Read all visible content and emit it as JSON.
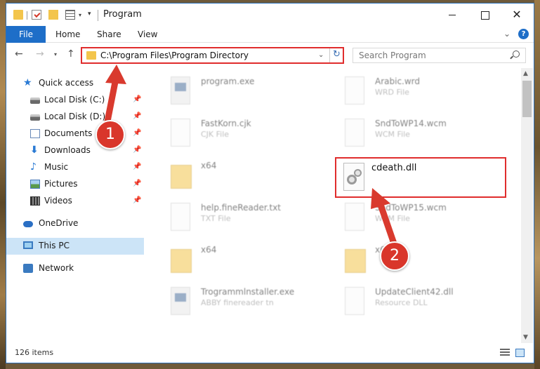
{
  "window": {
    "title": "Program"
  },
  "ribbon": {
    "tabs": [
      "File",
      "Home",
      "Share",
      "View"
    ]
  },
  "address_bar": {
    "path": "C:\\Program Files\\Program Directory"
  },
  "search": {
    "placeholder": "Search Program"
  },
  "sidebar": {
    "quick_access": "Quick access",
    "items": [
      {
        "label": "Local Disk (C:)",
        "icon": "disk-icon",
        "pinned": true
      },
      {
        "label": "Local Disk (D:)",
        "icon": "disk-icon",
        "pinned": true
      },
      {
        "label": "Documents",
        "icon": "documents-icon",
        "pinned": true
      },
      {
        "label": "Downloads",
        "icon": "downloads-icon",
        "pinned": true
      },
      {
        "label": "Music",
        "icon": "music-icon",
        "pinned": true
      },
      {
        "label": "Pictures",
        "icon": "pictures-icon",
        "pinned": true
      },
      {
        "label": "Videos",
        "icon": "videos-icon",
        "pinned": true
      }
    ],
    "onedrive": "OneDrive",
    "this_pc": "This PC",
    "network": "Network"
  },
  "files": [
    {
      "name": "program.exe",
      "type": ""
    },
    {
      "name": "Arabic.wrd",
      "type": "WRD File"
    },
    {
      "name": "FastKorn.cjk",
      "type": "CJK File"
    },
    {
      "name": "SndToWP14.wcm",
      "type": "WCM File"
    },
    {
      "name": "x64",
      "type": ""
    },
    {
      "name": "help.fineReader.txt",
      "type": "TXT File"
    },
    {
      "name": "SndToWP15.wcm",
      "type": "WCM File"
    },
    {
      "name": "x64",
      "type": ""
    },
    {
      "name": "x64",
      "type": ""
    },
    {
      "name": "Trogrammlnstaller.exe",
      "type": "ABBY finereader tn"
    },
    {
      "name": "UpdateClient42.dll",
      "type": "Resource DLL"
    }
  ],
  "highlighted_file": {
    "name": "cdeath.dll"
  },
  "status": {
    "item_count": "126 items"
  },
  "callouts": {
    "step1": "1",
    "step2": "2"
  },
  "colors": {
    "accent": "#1e6ec8",
    "highlight_red": "#e02d2d",
    "callout_red": "#d9362b",
    "selected_bg": "#cce4f7"
  }
}
